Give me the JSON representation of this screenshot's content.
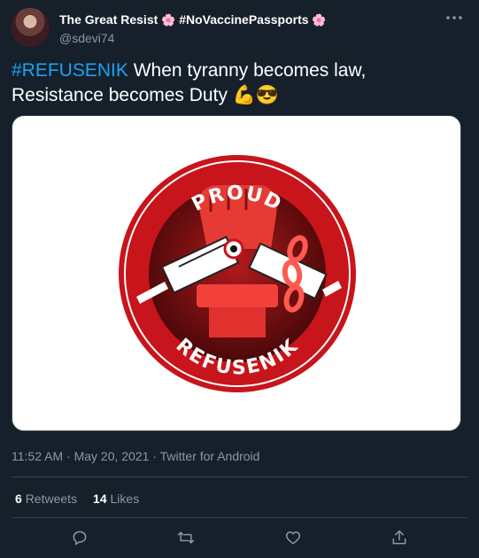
{
  "author": {
    "display_name": "The Great Resist",
    "display_name_tag": "#NoVaccinePassports",
    "flower_emoji": "🌸",
    "handle": "@sdevi74"
  },
  "tweet": {
    "hashtag": "#REFUSENIK",
    "text": " When tyranny becomes law, Resistance becomes Duty ",
    "emojis": "💪😎"
  },
  "image": {
    "top_text": "PROUD",
    "bottom_text": "REFUSENIK",
    "colors": {
      "ring": "#c8141b",
      "inner": "#6b0f10",
      "white": "#ffffff"
    }
  },
  "meta": {
    "time": "11:52 AM",
    "date": "May 20, 2021",
    "separator": "·",
    "source": "Twitter for Android"
  },
  "stats": {
    "retweets_count": "6",
    "retweets_label": "Retweets",
    "likes_count": "14",
    "likes_label": "Likes"
  },
  "actions": [
    "reply-icon",
    "retweet-icon",
    "like-icon",
    "share-icon"
  ],
  "colors": {
    "background": "#15202b",
    "accent": "#1da1f2",
    "muted": "#8899a6",
    "border": "#38444d"
  }
}
